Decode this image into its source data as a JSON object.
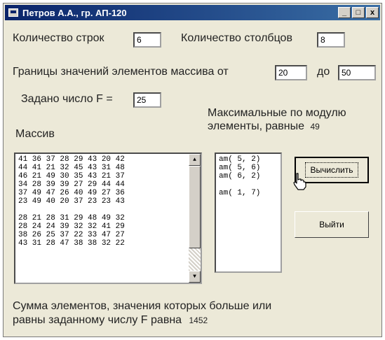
{
  "window": {
    "title": "Петров А.А., гр. АП-120",
    "minimize": "_",
    "maximize": "□",
    "close": "x"
  },
  "rows_label": "Количество строк",
  "rows_value": "6",
  "cols_label": "Количество столбцов",
  "cols_value": "8",
  "range_label": "Границы значений элементов массива от",
  "range_from": "20",
  "range_to_label": "до",
  "range_to": "50",
  "f_label": "Задано число F =",
  "f_value": "25",
  "max_label": "Максимальные по модулю элементы, равные",
  "max_value": "49",
  "array_label": "Массив",
  "array_rows": [
    "41 36 37 28 29 43 20 42",
    "44 41 21 32 45 43 31 48",
    "46 21 49 30 35 43 21 37",
    "34 28 39 39 27 29 44 44",
    "37 49 47 26 40 49 27 36",
    "23 49 40 20 37 23 23 43",
    "",
    "28 21 28 31 29 48 49 32",
    "28 24 24 39 32 32 41 29",
    "38 26 25 37 22 33 47 27",
    "43 31 28 47 38 38 32 22"
  ],
  "positions": [
    "am( 5, 2)",
    "am( 5, 6)",
    "am( 6, 2)",
    "",
    "am( 1, 7)"
  ],
  "calc_button": "Вычислить",
  "exit_button": "Выйти",
  "sum_label_1": "Сумма элементов, значения которых больше или",
  "sum_label_2": "равны заданному числу F равна",
  "sum_value": "1452"
}
